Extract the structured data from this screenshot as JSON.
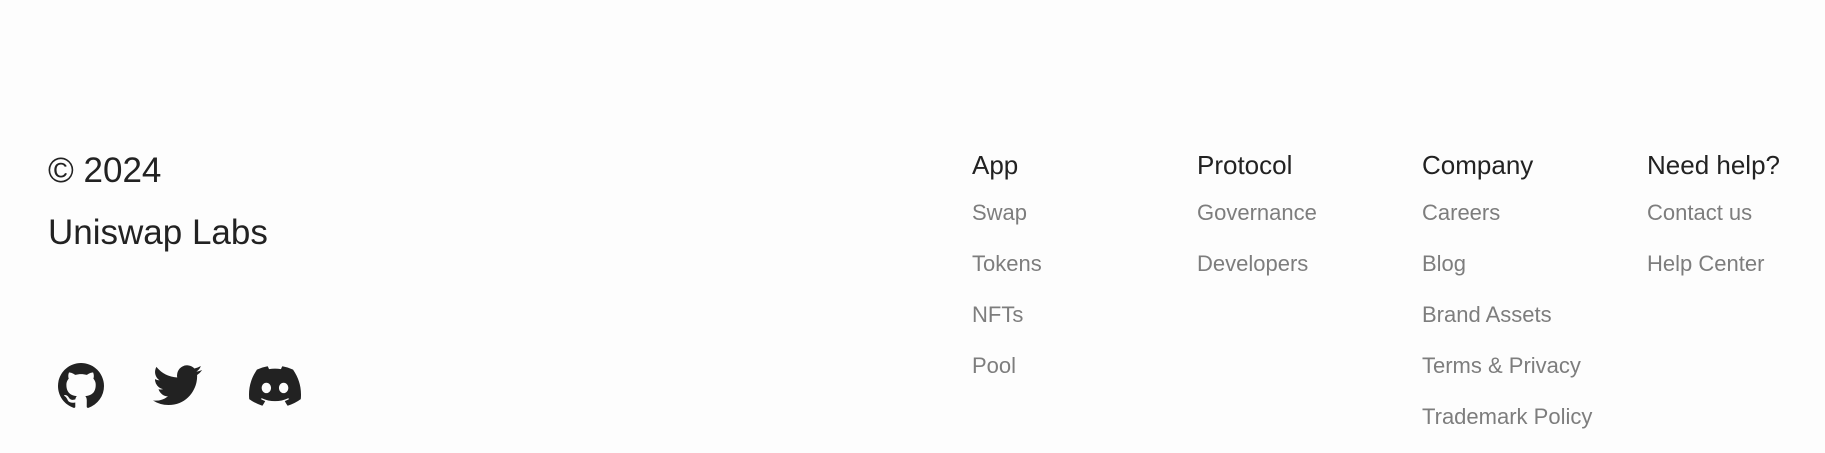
{
  "brand": {
    "copyright": "© 2024",
    "company": "Uniswap Labs"
  },
  "socials": [
    {
      "name": "GitHub",
      "icon": "github-icon"
    },
    {
      "name": "Twitter",
      "icon": "twitter-icon"
    },
    {
      "name": "Discord",
      "icon": "discord-icon"
    }
  ],
  "columns": {
    "app": {
      "heading": "App",
      "links": [
        "Swap",
        "Tokens",
        "NFTs",
        "Pool"
      ]
    },
    "protocol": {
      "heading": "Protocol",
      "links": [
        "Governance",
        "Developers"
      ]
    },
    "company": {
      "heading": "Company",
      "links": [
        "Careers",
        "Blog",
        "Brand Assets",
        "Terms & Privacy",
        "Trademark Policy"
      ]
    },
    "help": {
      "heading": "Need help?",
      "links": [
        "Contact us",
        "Help Center"
      ]
    }
  },
  "colors": {
    "background": "#fdfdfd",
    "heading": "#222222",
    "link": "#7d7d7d",
    "icon": "#222222"
  }
}
